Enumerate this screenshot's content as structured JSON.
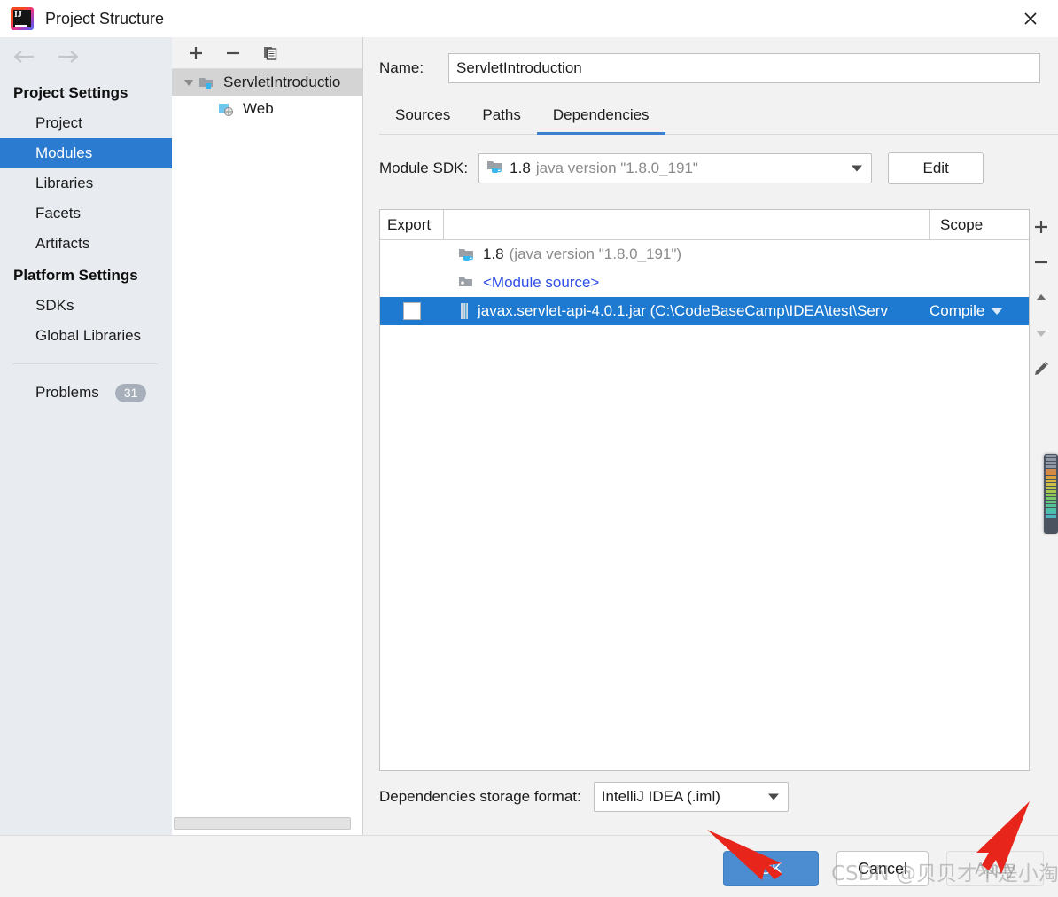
{
  "window": {
    "title": "Project Structure",
    "logo_icon": "intellij-idea-logo",
    "close_icon": "close-icon"
  },
  "sidebar": {
    "back_icon": "arrow-left-icon",
    "forward_icon": "arrow-right-icon",
    "groups": [
      {
        "title": "Project Settings",
        "items": [
          {
            "label": "Project",
            "selected": false
          },
          {
            "label": "Modules",
            "selected": true
          },
          {
            "label": "Libraries",
            "selected": false
          },
          {
            "label": "Facets",
            "selected": false
          },
          {
            "label": "Artifacts",
            "selected": false
          }
        ]
      },
      {
        "title": "Platform Settings",
        "items": [
          {
            "label": "SDKs",
            "selected": false
          },
          {
            "label": "Global Libraries",
            "selected": false
          }
        ]
      }
    ],
    "problems": {
      "label": "Problems",
      "count": "31"
    },
    "help_label": "?"
  },
  "tree": {
    "toolbar": [
      {
        "icon": "plus-icon"
      },
      {
        "icon": "minus-icon"
      },
      {
        "icon": "copy-icon"
      }
    ],
    "nodes": [
      {
        "label": "ServletIntroductio",
        "icon": "module-folder-icon",
        "selected": true,
        "expanded": true,
        "child": false
      },
      {
        "label": "Web",
        "icon": "web-facet-icon",
        "selected": false,
        "child": true
      }
    ]
  },
  "main": {
    "name_label": "Name:",
    "name_value": "ServletIntroduction",
    "tabs": [
      {
        "label": "Sources",
        "active": false
      },
      {
        "label": "Paths",
        "active": false
      },
      {
        "label": "Dependencies",
        "active": true
      }
    ],
    "module_sdk": {
      "label": "Module SDK:",
      "icon": "java-sdk-icon",
      "version": "1.8",
      "description": "java version \"1.8.0_191\"",
      "edit_label": "Edit"
    },
    "table": {
      "columns": [
        "Export",
        "",
        "Scope"
      ],
      "rows": [
        {
          "checkbox": false,
          "has_checkbox": false,
          "icon": "java-sdk-icon",
          "name_main": "1.8",
          "name_dim": "(java version \"1.8.0_191\")",
          "scope": "",
          "selected": false,
          "link": false
        },
        {
          "checkbox": false,
          "has_checkbox": false,
          "icon": "module-source-icon",
          "name_main": "<Module source>",
          "name_dim": "",
          "scope": "",
          "selected": false,
          "link": true
        },
        {
          "checkbox": false,
          "has_checkbox": true,
          "icon": "jar-file-icon",
          "name_main": "javax.servlet-api-4.0.1.jar (C:\\CodeBaseCamp\\IDEA\\test\\Serv",
          "name_dim": "",
          "scope": "Compile",
          "selected": true,
          "link": false
        }
      ],
      "side_buttons": [
        {
          "icon": "plus-icon"
        },
        {
          "icon": "minus-icon"
        },
        {
          "icon": "arrow-up-icon"
        },
        {
          "icon": "arrow-down-icon"
        },
        {
          "icon": "pencil-edit-icon"
        }
      ]
    },
    "storage": {
      "label": "Dependencies storage format:",
      "value": "IntelliJ IDEA (.iml)"
    }
  },
  "footer": {
    "ok_label": "OK",
    "cancel_label": "Cancel",
    "apply_label": "Apply"
  },
  "annotations": {
    "watermark": "CSDN @贝贝才不是小淘气",
    "arrow_color": "#e8251b"
  },
  "colors": {
    "selection_blue": "#2b7cd0",
    "table_selection_blue": "#1e7ad0",
    "tab_underline": "#3f7fd0",
    "link_blue": "#2f4fe8",
    "ok_button": "#4b8dd0"
  }
}
